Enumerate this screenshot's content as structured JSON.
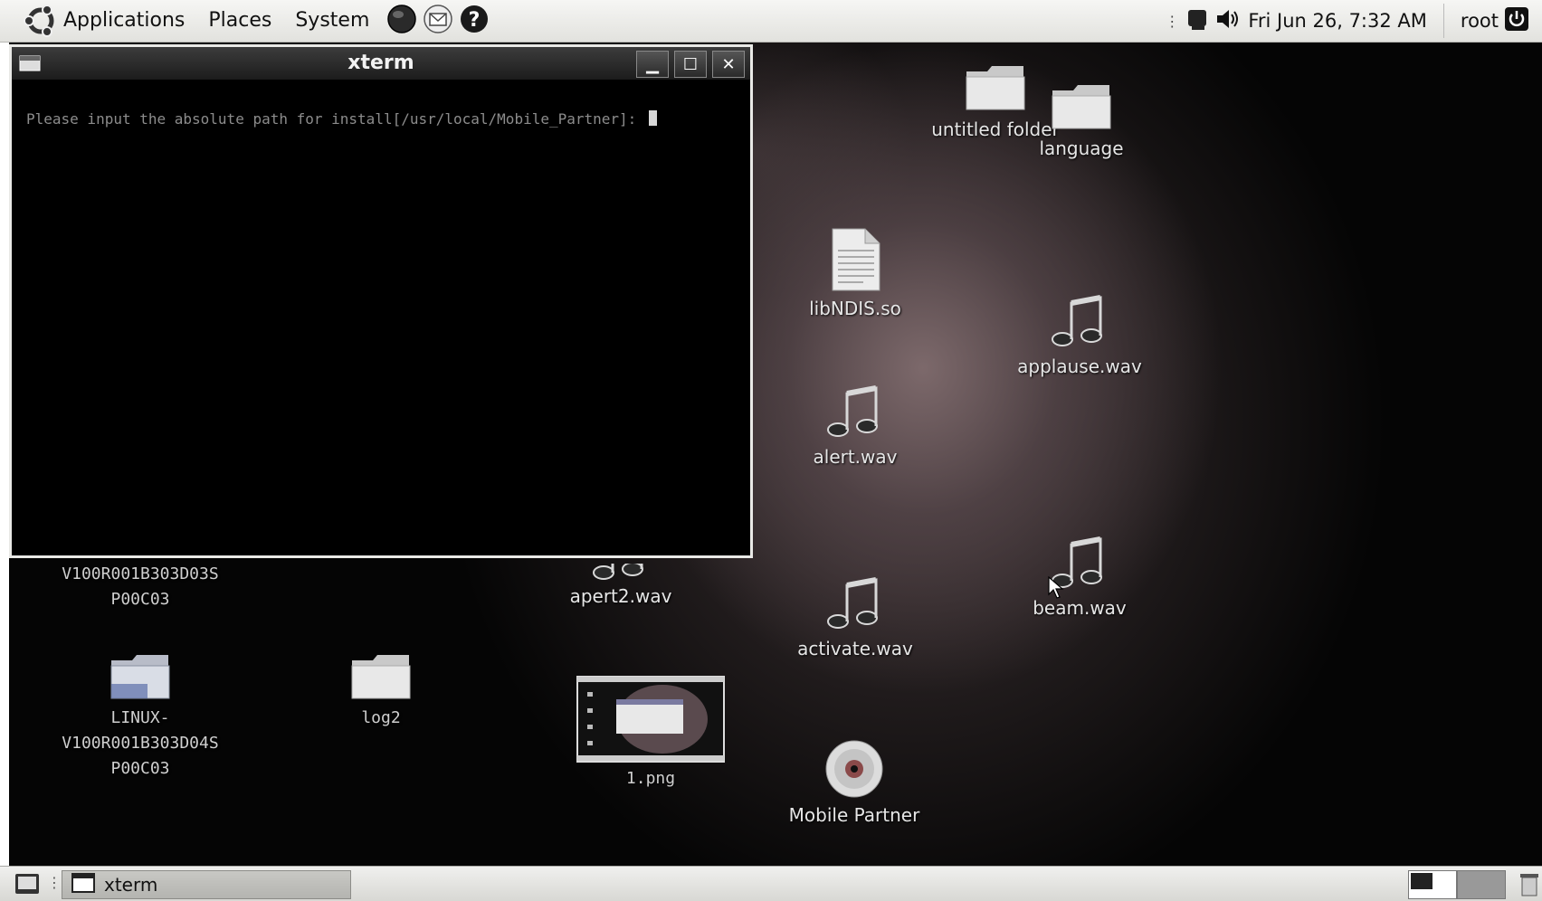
{
  "top_panel": {
    "menus": [
      "Applications",
      "Places",
      "System"
    ],
    "clock": "Fri Jun 26,  7:32 AM",
    "user": "root"
  },
  "xterm": {
    "title": "xterm",
    "prompt": "Please input the absolute path for install[/usr/local/Mobile_Partner]: "
  },
  "desktop_icons": {
    "untitled_folder": "untitled folder",
    "language": "language",
    "libndis": "libNDIS.so",
    "applause": "applause.wav",
    "alert": "alert.wav",
    "beam": "beam.wav",
    "activate": "activate.wav",
    "apert2": "apert2.wav",
    "dir1_line1": "V100R001B303D03S",
    "dir1_line2": "P00C03",
    "dir2_line1": "LINUX-",
    "dir2_line2": "V100R001B303D04S",
    "dir2_line3": "P00C03",
    "log2": "log2",
    "png": "1.png",
    "mobile_partner": "Mobile Partner"
  },
  "bottom_panel": {
    "task_label": "xterm"
  }
}
